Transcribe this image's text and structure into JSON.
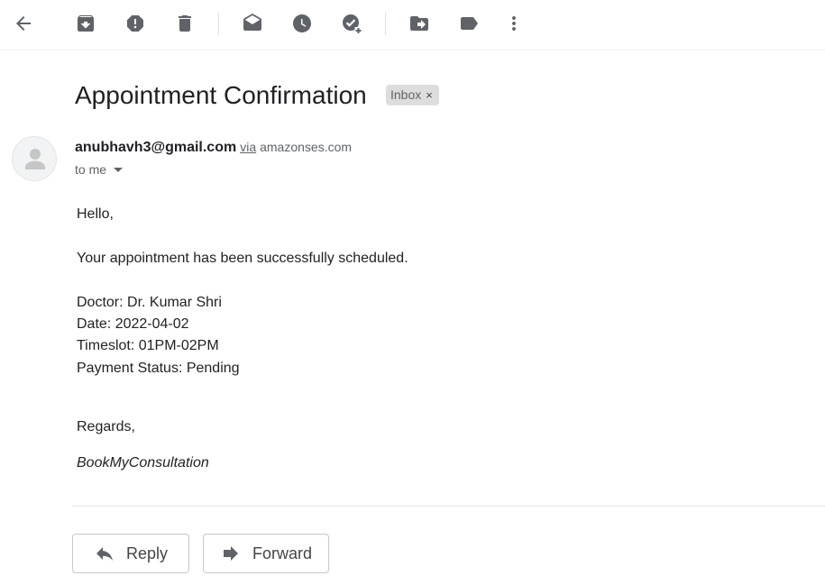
{
  "toolbar": {
    "icons": [
      "back-arrow-icon",
      "archive-icon",
      "report-spam-icon",
      "delete-icon",
      "mark-unread-icon",
      "snooze-icon",
      "add-to-tasks-icon",
      "move-to-icon",
      "label-icon",
      "more-vert-icon"
    ],
    "icon_color": "#444746"
  },
  "email": {
    "subject": "Appointment Confirmation",
    "label": "Inbox",
    "label_close": "×",
    "sender_email": "anubhavh3@gmail.com",
    "via_text": "via",
    "via_domain": "amazonses.com",
    "to_text": "to me",
    "body": {
      "greeting": "Hello,",
      "message": "Your appointment has been successfully scheduled.",
      "doctor": "Doctor: Dr. Kumar Shri",
      "date": "Date: 2022-04-02",
      "timeslot": "Timeslot: 01PM-02PM",
      "payment_status": "Payment Status: Pending",
      "regards": "Regards,",
      "signature": "BookMyConsultation"
    }
  },
  "actions": {
    "reply": "Reply",
    "forward": "Forward"
  }
}
